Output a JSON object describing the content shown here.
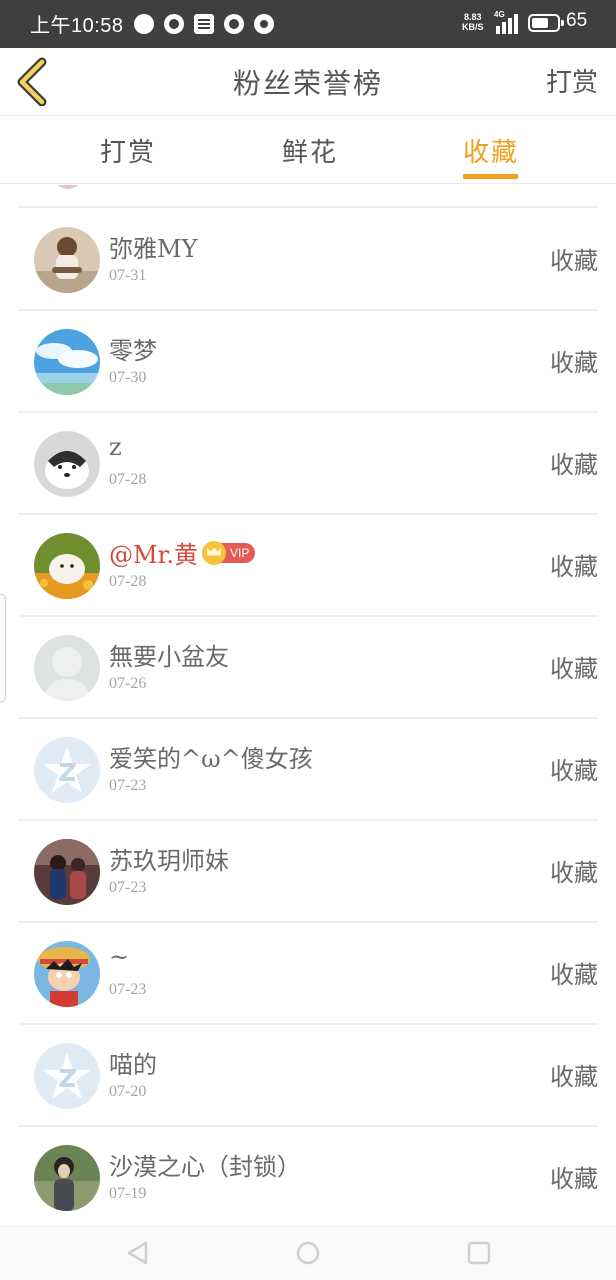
{
  "status_bar": {
    "time": "上午10:58",
    "net_speed_value": "8.83",
    "net_speed_unit": "KB/S",
    "network_type": "4G",
    "battery": "65",
    "battery_level": 0.65,
    "icons": [
      "message-icon",
      "wechat-icon",
      "notes-icon",
      "app-icon",
      "app2-icon"
    ]
  },
  "header": {
    "title": "粉丝荣誉榜",
    "action": "打赏"
  },
  "tabs": [
    {
      "label": "打赏",
      "active": false
    },
    {
      "label": "鲜花",
      "active": false
    },
    {
      "label": "收藏",
      "active": true
    }
  ],
  "list": [
    {
      "name": "弥雅MY",
      "date": "07-31",
      "action": "收藏",
      "vip": false
    },
    {
      "name": "零梦",
      "date": "07-30",
      "action": "收藏",
      "vip": false
    },
    {
      "name": "z",
      "date": "07-28",
      "action": "收藏",
      "vip": false
    },
    {
      "name": "@Mr.黄",
      "date": "07-28",
      "action": "收藏",
      "vip": true,
      "vip_label": "VIP"
    },
    {
      "name": "無要小盆友",
      "date": "07-26",
      "action": "收藏",
      "vip": false
    },
    {
      "name": "爱笑的^ω^傻女孩",
      "date": "07-23",
      "action": "收藏",
      "vip": false
    },
    {
      "name": "苏玖玥师妹",
      "date": "07-23",
      "action": "收藏",
      "vip": false
    },
    {
      "name": "~",
      "date": "07-23",
      "action": "收藏",
      "vip": false
    },
    {
      "name": "喵的",
      "date": "07-20",
      "action": "收藏",
      "vip": false
    },
    {
      "name": "沙漠之心（封锁）",
      "date": "07-19",
      "action": "收藏",
      "vip": false
    }
  ],
  "colors": {
    "accent": "#f0a01e",
    "vip_name": "#d9463a",
    "status_bar": "#3f3f3f"
  }
}
